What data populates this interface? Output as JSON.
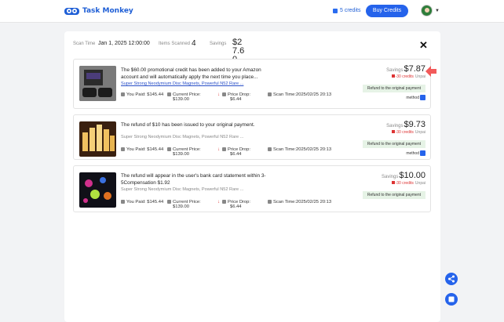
{
  "header": {
    "brand": "Task Monkey",
    "credits": "5 credits",
    "buy_label": "Buy Credits",
    "colors": {
      "brand": "#1f5fd6",
      "button": "#2563eb"
    }
  },
  "summary": {
    "scan_time_label": "Scan Time",
    "scan_time_value": "Jan 1, 2025 12:00:00",
    "items_label": "Items Scanned",
    "items_value": "4",
    "savings_label": "Savings",
    "savings_value": "$27.60"
  },
  "cards": [
    {
      "title": "The $60.00 promotional credit has been added to your Amazon account and will automatically apply the next time you place...",
      "product": "Super Strong Neodymium Disc Magnets, Powerful N52 Rare ...",
      "paid_label": "You Paid:",
      "paid_value": "$145.44",
      "current_label": "Current Price:",
      "current_value": "$139.00",
      "drop_label": "Price Drop:",
      "drop_value": "$6.44",
      "scan_label": "Scan Time:",
      "scan_value": "2025/02/25 20:13",
      "savings_label": "Savings",
      "savings_value": "$7.87",
      "credits": "-30 credits",
      "status": "Unpai",
      "refund_method": "Refund to the original payment",
      "method_label": "method"
    },
    {
      "title": "The refund of $10 has been issued to your original payment.",
      "product": "Super Strong Neodymium Disc Magnets, Powerful N52 Rare ...",
      "paid_label": "You Paid:",
      "paid_value": "$145.44",
      "current_label": "Current Price:",
      "current_value": "$139.00",
      "drop_label": "Price Drop:",
      "drop_value": "$6.44",
      "scan_label": "Scan Time:",
      "scan_value": "2025/02/25 20:13",
      "savings_label": "Savings",
      "savings_value": "$9.73",
      "credits": "-30 credits",
      "status": "Unpai",
      "refund_method": "Refund to the original payment",
      "method_label": "method"
    },
    {
      "title": "The refund will appear in the user's bank card statement within 3-5Compensation $1.92",
      "product": "Super Strong Neodymium Disc Magnets, Powerful N52 Rare ...",
      "paid_label": "You Paid:",
      "paid_value": "$145.44",
      "current_label": "Current Price:",
      "current_value": "$139.00",
      "drop_label": "Price Drop:",
      "drop_value": "$6.44",
      "scan_label": "Scan Time:",
      "scan_value": "2025/02/25 20:13",
      "savings_label": "Savings",
      "savings_value": "$10.00",
      "credits": "-30 credits",
      "status": "Unpai",
      "refund_method": "Refund to the original payment",
      "method_label": "method"
    }
  ],
  "icons": [
    "logo-icon",
    "coin-icon",
    "avatar",
    "chevron-down-icon",
    "close-icon",
    "wallet-icon",
    "tag-icon",
    "price-drop-icon",
    "clock-icon",
    "chat-icon",
    "share-icon",
    "stop-icon",
    "arrow-left-icon"
  ]
}
